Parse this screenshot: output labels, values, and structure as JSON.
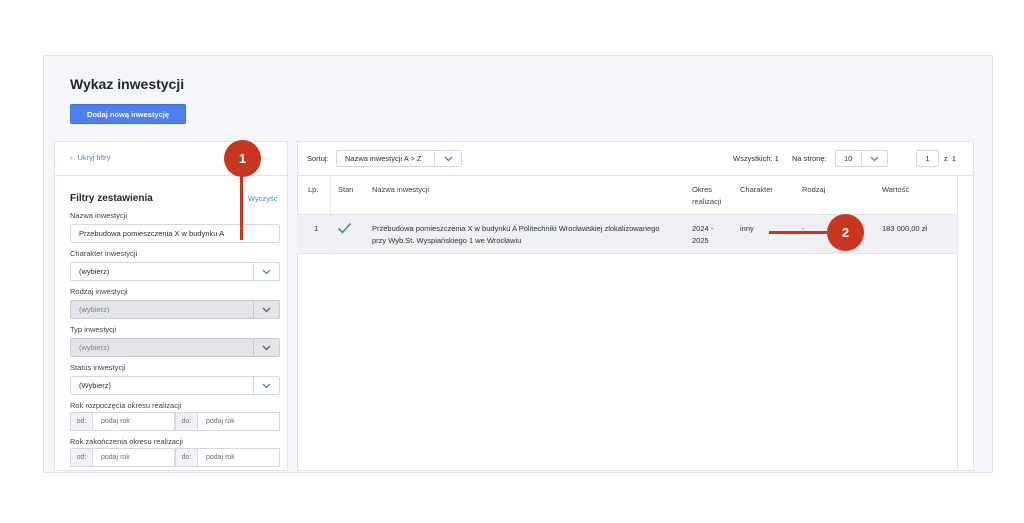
{
  "page": {
    "title": "Wykaz inwestycji",
    "add_button": "Dodaj nową inwestycję"
  },
  "filters": {
    "hide_link": "Ukryj filtry",
    "title": "Filtry zestawienia",
    "clear": "Wyczyść",
    "name_label": "Nazwa inwestycji",
    "name_value": "Przebudowa pomieszczenia X w budynku A",
    "character_label": "Charakter inwestycji",
    "character_value": "(wybierz)",
    "kind_label": "Rodzaj inwestycji",
    "kind_value": "(wybierz)",
    "type_label": "Typ inwestycji",
    "type_value": "(wybierz)",
    "status_label": "Status inwestycji",
    "status_value": "(Wybierz)",
    "start_year_label": "Rok rozpoczęcia okresu realizacji",
    "end_year_label": "Rok zakończenia okresu realizacji",
    "from_prefix": "od:",
    "to_prefix": "do:",
    "year_placeholder": "podaj rok"
  },
  "toolbar": {
    "sort_label": "Sortuj:",
    "sort_value": "Nazwa inwestycji A > Z",
    "total": "Wszystkich: 1",
    "per_page_label": "Na stronę:",
    "per_page_value": "10",
    "page_value": "1",
    "page_of": "z",
    "page_total": "1"
  },
  "table": {
    "headers": {
      "lp": "Lp.",
      "status": "Stan",
      "name": "Nazwa inwestycji",
      "period_1": "Okres",
      "period_2": "realizacji",
      "character": "Charakter",
      "kind": "Rodzaj",
      "value": "Wartość"
    },
    "rows": [
      {
        "lp": "1",
        "status_icon": "checkmark-icon",
        "name_1": "Przebudowa pomieszczenia X w budynku A Politechniki Wrocławskiej zlokalizowanego",
        "name_2": "przy Wyb.St. Wyspiańskiego 1 we Wrocławiu",
        "period_1": "2024 -",
        "period_2": "2025",
        "character": "inny",
        "kind": "-",
        "value": "183 000,00 zł"
      }
    ]
  },
  "annotations": {
    "marker_1": "1",
    "marker_2": "2"
  },
  "colors": {
    "accent": "#4d7ff0",
    "marker": "#c9361f",
    "check": "#2e9e6b"
  }
}
